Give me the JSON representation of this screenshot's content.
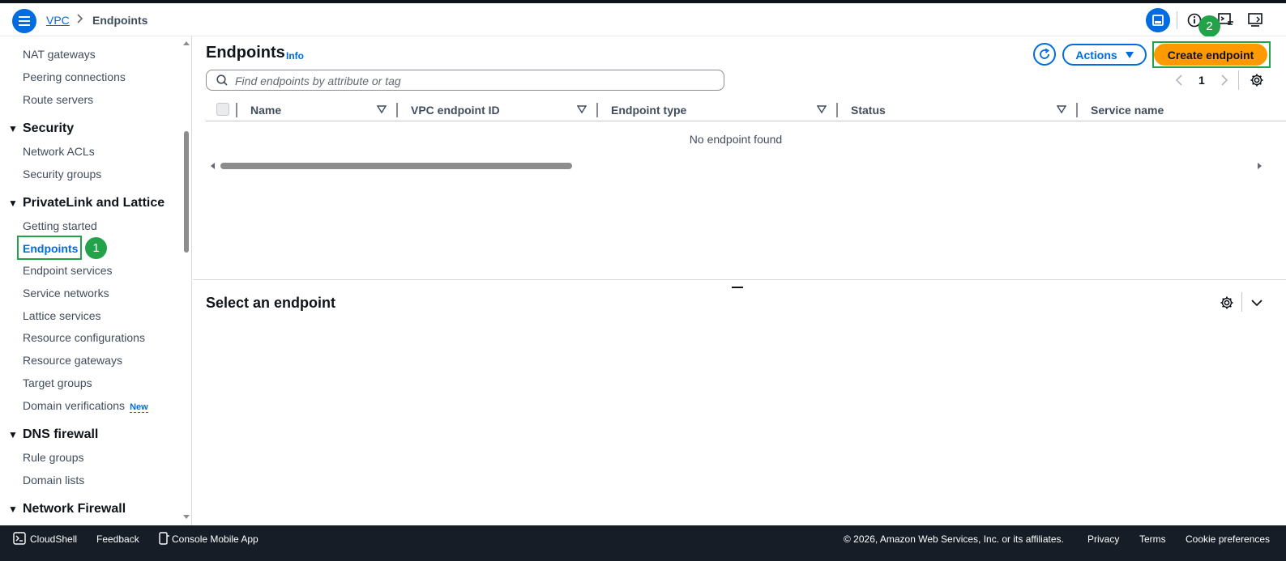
{
  "header": {
    "breadcrumb": [
      "VPC",
      "Endpoints"
    ]
  },
  "badges": [
    "1",
    "2"
  ],
  "sidebar": {
    "items_top": [
      "NAT gateways",
      "Peering connections",
      "Route servers"
    ],
    "sections": [
      {
        "title": "Security",
        "items": [
          "Network ACLs",
          "Security groups"
        ]
      },
      {
        "title": "PrivateLink and Lattice",
        "items": [
          "Getting started",
          "Endpoints",
          "Endpoint services",
          "Service networks",
          "Lattice services",
          "Resource configurations",
          "Resource gateways",
          "Target groups",
          "Domain verifications"
        ]
      },
      {
        "title": "DNS firewall",
        "items": [
          "Rule groups",
          "Domain lists"
        ]
      },
      {
        "title": "Network Firewall",
        "items": []
      }
    ],
    "new_tag": "New",
    "active_item": "Endpoints"
  },
  "main": {
    "title": "Endpoints",
    "info": "Info",
    "actions_label": "Actions",
    "create_label": "Create endpoint",
    "search_placeholder": "Find endpoints by attribute or tag",
    "page": "1",
    "columns": [
      "Name",
      "VPC endpoint ID",
      "Endpoint type",
      "Status",
      "Service name"
    ],
    "empty_message": "No endpoint found",
    "split_title": "Select an endpoint"
  },
  "footer": {
    "cloudshell": "CloudShell",
    "feedback": "Feedback",
    "mobile_app": "Console Mobile App",
    "copyright": "© 2026, Amazon Web Services, Inc. or its affiliates.",
    "privacy": "Privacy",
    "terms": "Terms",
    "cookies": "Cookie preferences"
  },
  "colors": {
    "accent": "#006ce0",
    "primary_button": "#ff9900",
    "highlight": "#22a34a",
    "footer_bg": "#161d26"
  }
}
